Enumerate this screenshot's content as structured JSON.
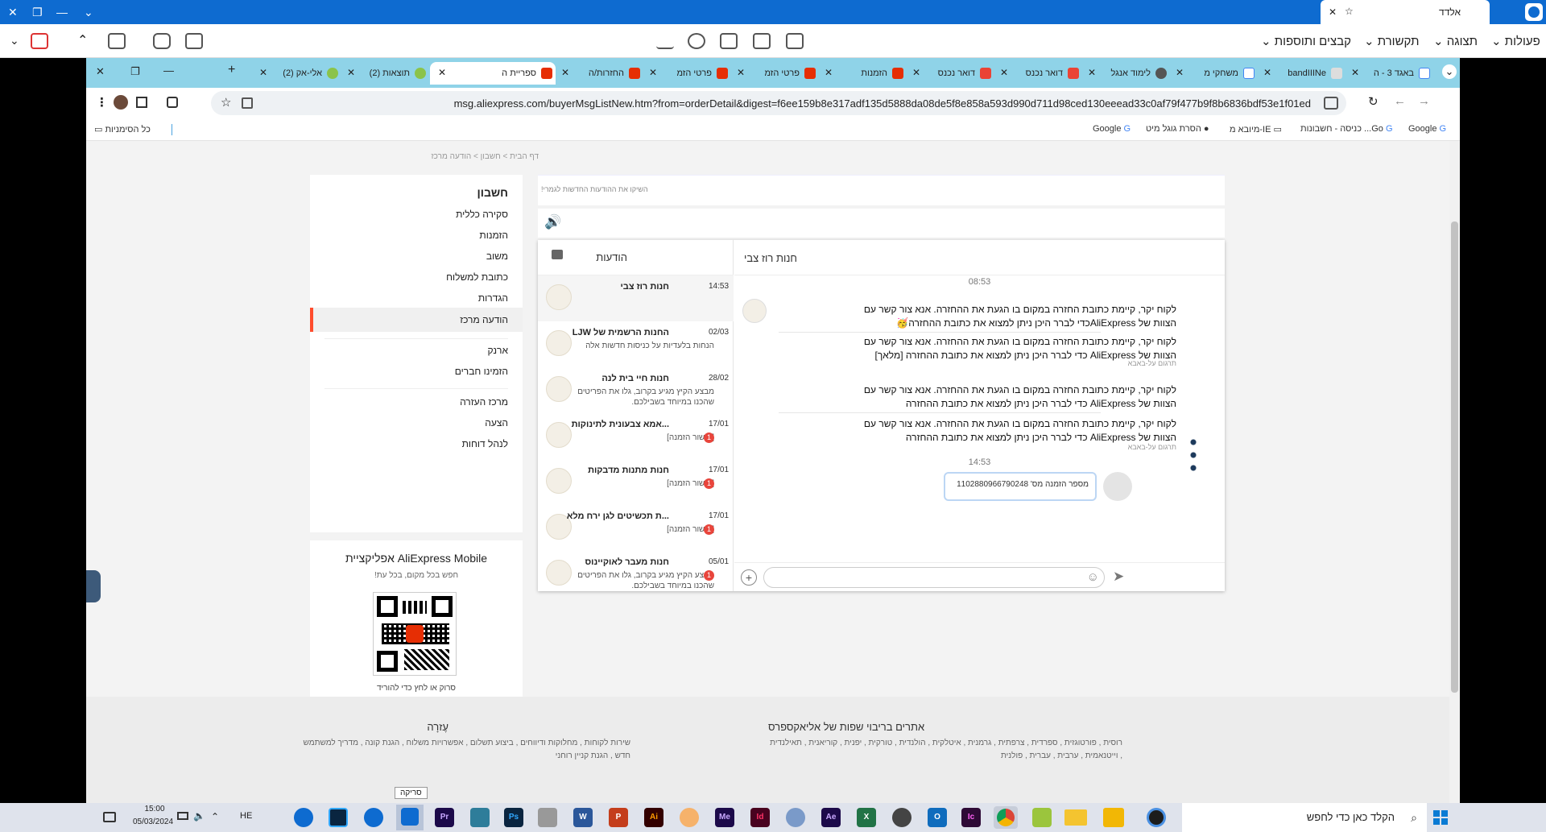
{
  "teamviewer": {
    "tab_title": "אלדד",
    "menus": [
      "פעולות",
      "תצוגה",
      "תקשורת",
      "קבצים ותוספות"
    ]
  },
  "browser": {
    "tabs": [
      {
        "label": "באגד 3 - ה"
      },
      {
        "label": "bandIIINe"
      },
      {
        "label": "משחקי מ"
      },
      {
        "label": "לימוד אנגל"
      },
      {
        "label": "דואר נכנס"
      },
      {
        "label": "דואר נכנס"
      },
      {
        "label": "הזמנות"
      },
      {
        "label": "פרטי הזמ"
      },
      {
        "label": "פרטי הזמ"
      },
      {
        "label": "החזרות/ה"
      },
      {
        "label": "ספריית ה",
        "active": true
      },
      {
        "label": "(2) תוצאות"
      },
      {
        "label": "(2) אלי-אק"
      }
    ],
    "url": "msg.aliexpress.com/buyerMsgListNew.htm?from=orderDetail&digest=f6ee159b8e317adf135d5888da08de5f8e858a593d990d711d98ced130eeead33c0af79f477b9f8b6836bdf53e1f01ed",
    "bookmarks": [
      "Google",
      "כניסה - חשבונות ...Go",
      "מיובא מ-IE",
      "הסרת גוגל מיט",
      "Google"
    ],
    "all_bookmarks": "כל הסימניות"
  },
  "page": {
    "breadcrumb": "דף הבית  >  חשבון  >  הודעה מרכז",
    "sidebar": {
      "title": "חשבון",
      "items": [
        "סקירה כללית",
        "הזמנות",
        "משוב",
        "כתובת למשלוח",
        "הגדרות",
        "הודעה מרכז",
        "ארנק",
        "הזמינו חברים",
        "מרכז העזרה",
        "הצעה",
        "לנהל דוחות"
      ]
    },
    "app": {
      "title": "אפליקציית AliExpress Mobile",
      "subtitle": "חפש בכל מקום, בכל עת!",
      "caption": "סרוק או לחץ כדי להוריד"
    },
    "banner": "השיקו את ההודעות החדשות לגמרי!",
    "messages_title": "הודעות",
    "conversations": [
      {
        "name": "חנות רוז צבי",
        "time": "14:53",
        "snippet": "",
        "badge": ""
      },
      {
        "name": "החנות הרשמית של LJW",
        "time": "02/03",
        "snippet": "הנחות בלעדיות על כניסות חדשות אלה",
        "badge": ""
      },
      {
        "name": "חנות חיי בית לנה",
        "time": "28/02",
        "snippet": "מבצע הקיץ מגיע בקרוב, גלו את הפריטים שהכנו במיוחד בשבילכם.",
        "badge": ""
      },
      {
        "name": "...אמא צבעונית לתינוקות",
        "time": "17/01",
        "snippet": "[אישור הזמנה]",
        "badge": "1"
      },
      {
        "name": "חנות מתנות מדבקות",
        "time": "17/01",
        "snippet": "[אישור הזמנה]",
        "badge": "1"
      },
      {
        "name": "...ת תכשיטים לגן ירח מלא",
        "time": "17/01",
        "snippet": "[אישור הזמנה]",
        "badge": "1"
      },
      {
        "name": "חנות מעבר לאוקיינוס",
        "time": "05/01",
        "snippet": "מבצע הקיץ מגיע בקרוב, גלו את הפריטים שהכנו במיוחד בשבילכם.",
        "badge": "1"
      }
    ],
    "chat": {
      "store_name": "חנות רוז צבי",
      "time1": "08:53",
      "time2": "14:53",
      "msg1": "לקוח יקר, קיימת כתובת החזרה במקום בו הגעת את ההחזרה. אנא צור קשר עם הצוות של AliExpressכדי לברר היכן ניתן למצוא את כתובת ההחזרה🥳",
      "msg1_trans": "לקוח יקר, קיימת כתובת החזרה במקום בו הגעת את ההחזרה. אנא צור קשר עם הצוות של AliExpress כדי לברר היכן ניתן למצוא את כתובת ההחזרה [מלאך]",
      "msg2": "לקוח יקר, קיימת כתובת החזרה במקום בו הגעת את ההחזרה. אנא צור קשר עם הצוות של AliExpress כדי לברר היכן ניתן למצוא את כתובת ההחזרה",
      "msg2_trans": "לקוח יקר, קיימת כתובת החזרה במקום בו הגעת את ההחזרה. אנא צור קשר עם הצוות של AliExpress כדי לברר היכן ניתן למצוא את כתובת ההחזרה",
      "translated_label": "תרגום על-באבא",
      "order_label": "מספר הזמנה מס' 1102880966790248"
    },
    "footer": {
      "help_title": "עֶזרָה",
      "help_text": "שירות לקוחות , מחלוקות ודיווחים , ביצוע תשלום , אפשרויות משלוח , הגנת קונה , מדריך למשתמש חדש , הגנת קניין רוחני",
      "langs_title": "אתרים בריבוי שפות של אליאקספרס",
      "langs_text": "רוסית , פורטוגזית , ספרדית , צרפתית , גרמנית , איטלקית , הולנדית , טורקית , יפנית , קוריאנית , תאילנדית , וייטנאמית , ערבית , עברית , פולנית",
      "tooltip": "סריקה"
    }
  },
  "taskbar": {
    "search": "הקלד כאן כדי לחפש",
    "lang": "HE",
    "time": "15:00",
    "date": "05/03/2024",
    "apps": [
      {
        "name": "Pr",
        "color": "#1c0a4a"
      },
      {
        "name": "Ps",
        "color": "#0a2540"
      },
      {
        "name": "W",
        "color": "#2b579a"
      },
      {
        "name": "P",
        "color": "#c43e1c"
      },
      {
        "name": "Ai",
        "color": "#330000"
      },
      {
        "name": "Me",
        "color": "#1c0a4a"
      },
      {
        "name": "Id",
        "color": "#49021f"
      },
      {
        "name": "Ae",
        "color": "#1c0a4a"
      },
      {
        "name": "X",
        "color": "#217346"
      },
      {
        "name": "O",
        "color": "#0f6cbd"
      },
      {
        "name": "Ic",
        "color": "#2e0a36"
      }
    ]
  }
}
